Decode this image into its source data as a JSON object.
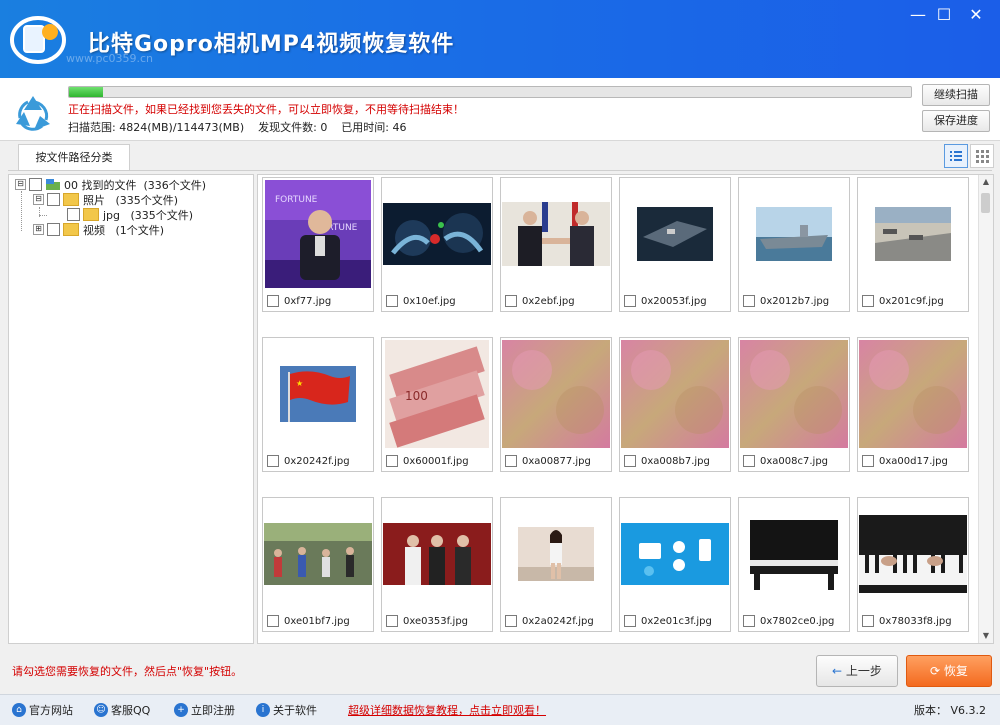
{
  "window": {
    "title": "比特Gopro相机MP4视频恢复软件",
    "watermark": "www.pc0359.cn",
    "controls": {
      "minimize": "—",
      "maximize": "☐",
      "close": "✕"
    }
  },
  "scan": {
    "progress_fraction": 0.04,
    "message": "正在扫描文件，如果已经找到您丢失的文件，可以立即恢复，不用等待扫描结束！",
    "stats": "扫描范围: 4824(MB)/114473(MB)    发现文件数: 0    已用时间: 46",
    "continue_label": "继续扫描",
    "save_label": "保存进度"
  },
  "tab": {
    "label": "按文件路径分类"
  },
  "tree": [
    {
      "label": "00 找到的文件  (336个文件)",
      "expander": "⊟"
    },
    {
      "label": "照片   (335个文件)",
      "expander": "⊟"
    },
    {
      "label": "jpg   (335个文件)",
      "expander": ""
    },
    {
      "label": "视频   (1个文件)",
      "expander": "⊞"
    }
  ],
  "files": [
    {
      "name": "0xf77.jpg",
      "thumb": "stage-speaker"
    },
    {
      "name": "0x10ef.jpg",
      "thumb": "hands-apple"
    },
    {
      "name": "0x2ebf.jpg",
      "thumb": "handshake"
    },
    {
      "name": "0x20053f.jpg",
      "thumb": "carrier-top"
    },
    {
      "name": "0x2012b7.jpg",
      "thumb": "carrier-side"
    },
    {
      "name": "0x201c9f.jpg",
      "thumb": "carrier-deck"
    },
    {
      "name": "0x20242f.jpg",
      "thumb": "flag"
    },
    {
      "name": "0x60001f.jpg",
      "thumb": "banknotes"
    },
    {
      "name": "0xa00877.jpg",
      "thumb": "pink-noise"
    },
    {
      "name": "0xa008b7.jpg",
      "thumb": "pink-noise"
    },
    {
      "name": "0xa008c7.jpg",
      "thumb": "pink-noise"
    },
    {
      "name": "0xa00d17.jpg",
      "thumb": "pink-noise"
    },
    {
      "name": "0xe01bf7.jpg",
      "thumb": "crowd"
    },
    {
      "name": "0xe0353f.jpg",
      "thumb": "wedding"
    },
    {
      "name": "0x2a0242f.jpg",
      "thumb": "woman"
    },
    {
      "name": "0x2e01c3f.jpg",
      "thumb": "app-icons"
    },
    {
      "name": "0x7802ce0.jpg",
      "thumb": "piano"
    },
    {
      "name": "0x78033f8.jpg",
      "thumb": "piano-keys"
    }
  ],
  "bottom": {
    "hint": "请勾选您需要恢复的文件，然后点\"恢复\"按钮。",
    "back_label": "上一步",
    "recover_label": "恢复"
  },
  "footer": {
    "links": [
      "官方网站",
      "客服QQ",
      "立即注册",
      "关于软件"
    ],
    "promo": "超级详细数据恢复教程，点击立即观看！",
    "version": "版本： V6.3.2"
  },
  "colors": {
    "accent": "#1a6fe6",
    "warning_text": "#d40000",
    "recover_button": "#f36a1f"
  }
}
